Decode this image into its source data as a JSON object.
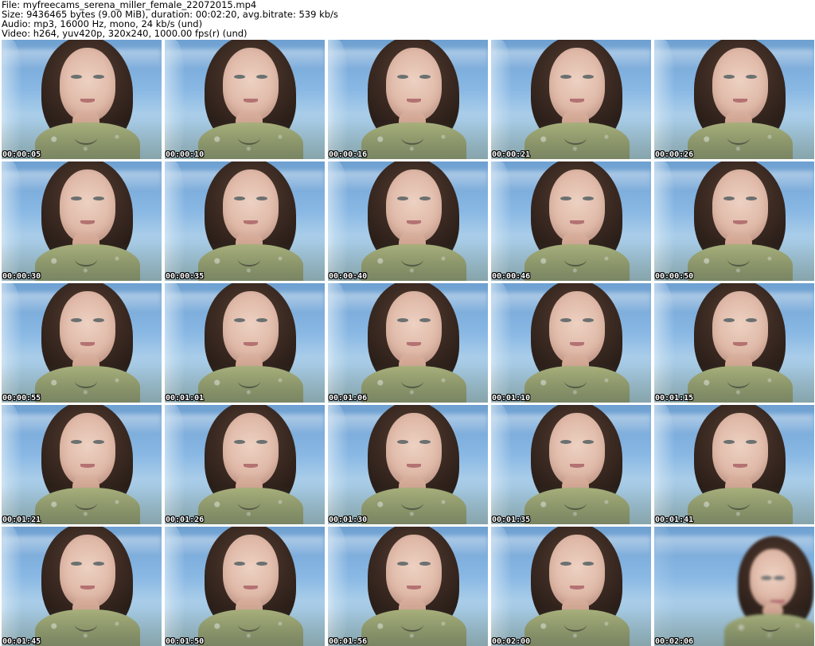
{
  "header": {
    "lines": [
      "File: myfreecams_serena_miller_female_22072015.mp4",
      "Size: 9436465 bytes (9.00 MiB), duration: 00:02:20, avg.bitrate: 539 kb/s",
      "Audio: mp3, 16000 Hz, mono, 24 kb/s (und)",
      "Video: h264, yuv420p, 320x240, 1000.00 fps(r) (und)"
    ]
  },
  "thumbnails": [
    {
      "timestamp": "00:00:05"
    },
    {
      "timestamp": "00:00:10"
    },
    {
      "timestamp": "00:00:16"
    },
    {
      "timestamp": "00:00:21"
    },
    {
      "timestamp": "00:00:26"
    },
    {
      "timestamp": "00:00:30"
    },
    {
      "timestamp": "00:00:35"
    },
    {
      "timestamp": "00:00:40"
    },
    {
      "timestamp": "00:00:46"
    },
    {
      "timestamp": "00:00:50"
    },
    {
      "timestamp": "00:00:55"
    },
    {
      "timestamp": "00:01:01"
    },
    {
      "timestamp": "00:01:06"
    },
    {
      "timestamp": "00:01:10"
    },
    {
      "timestamp": "00:01:15"
    },
    {
      "timestamp": "00:01:21"
    },
    {
      "timestamp": "00:01:26"
    },
    {
      "timestamp": "00:01:30"
    },
    {
      "timestamp": "00:01:35"
    },
    {
      "timestamp": "00:01:41"
    },
    {
      "timestamp": "00:01:45"
    },
    {
      "timestamp": "00:01:50"
    },
    {
      "timestamp": "00:01:56"
    },
    {
      "timestamp": "00:02:00"
    },
    {
      "timestamp": "00:02:06"
    }
  ]
}
